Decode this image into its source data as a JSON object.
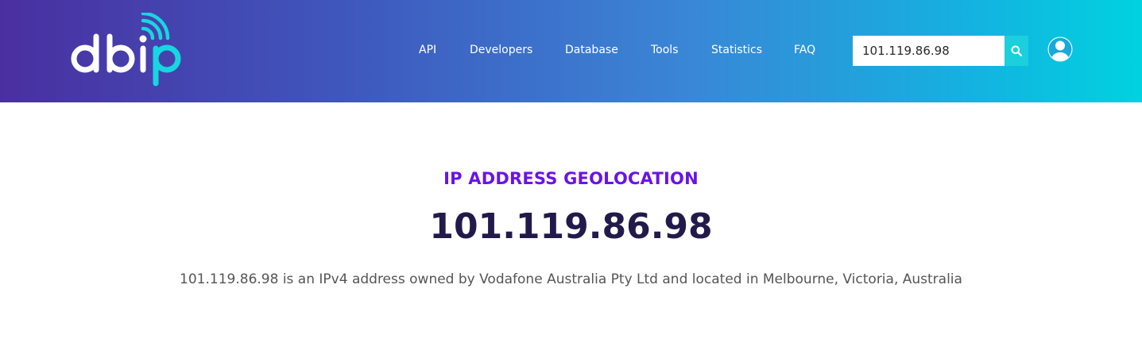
{
  "brand": {
    "logo_text": "dbip",
    "logo_icon": "wifi-signal-icon",
    "colors": {
      "accent": "#1bd0dc",
      "kicker": "#6a13e8",
      "title": "#211a4a"
    }
  },
  "nav": {
    "items": [
      {
        "label": "API"
      },
      {
        "label": "Developers"
      },
      {
        "label": "Database"
      },
      {
        "label": "Tools"
      },
      {
        "label": "Statistics"
      },
      {
        "label": "FAQ"
      }
    ]
  },
  "search": {
    "value": "101.119.86.98",
    "button_icon": "search-icon"
  },
  "user": {
    "icon": "user-icon"
  },
  "main": {
    "kicker": "IP ADDRESS GEOLOCATION",
    "ip": "101.119.86.98",
    "description": "101.119.86.98 is an IPv4 address owned by Vodafone Australia Pty Ltd and located in Melbourne, Victoria, Australia"
  }
}
